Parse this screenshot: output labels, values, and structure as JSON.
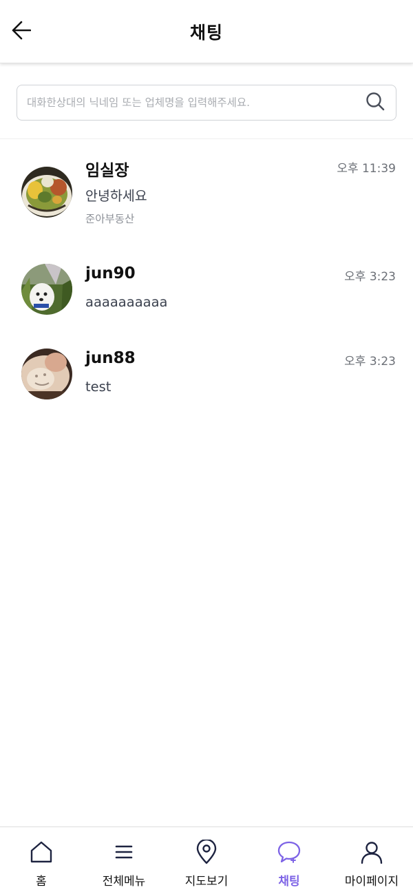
{
  "header": {
    "title": "채팅",
    "back_icon": "arrow-left-icon"
  },
  "search": {
    "placeholder": "대화한상대의 닉네임 또는 업체명을 입력해주세요.",
    "value": "",
    "icon": "search-icon"
  },
  "chats": [
    {
      "name": "임실장",
      "time": "오후 11:39",
      "message": "안녕하세요",
      "company": "준아부동산",
      "avatar": "food-photo-avatar"
    },
    {
      "name": "jun90",
      "time": "오후 3:23",
      "message": "aaaaaaaaaa",
      "company": "",
      "avatar": "dog-photo-avatar"
    },
    {
      "name": "jun88",
      "time": "오후 3:23",
      "message": "test",
      "company": "",
      "avatar": "pastry-photo-avatar"
    }
  ],
  "bottom_nav": {
    "items": [
      {
        "label": "홈",
        "icon": "home-icon"
      },
      {
        "label": "전체메뉴",
        "icon": "menu-icon"
      },
      {
        "label": "지도보기",
        "icon": "map-pin-icon"
      },
      {
        "label": "채팅",
        "icon": "chat-icon",
        "active": true
      },
      {
        "label": "마이페이지",
        "icon": "user-icon"
      }
    ],
    "active_color": "#7d63e6",
    "icon_color": "#1d2340"
  }
}
